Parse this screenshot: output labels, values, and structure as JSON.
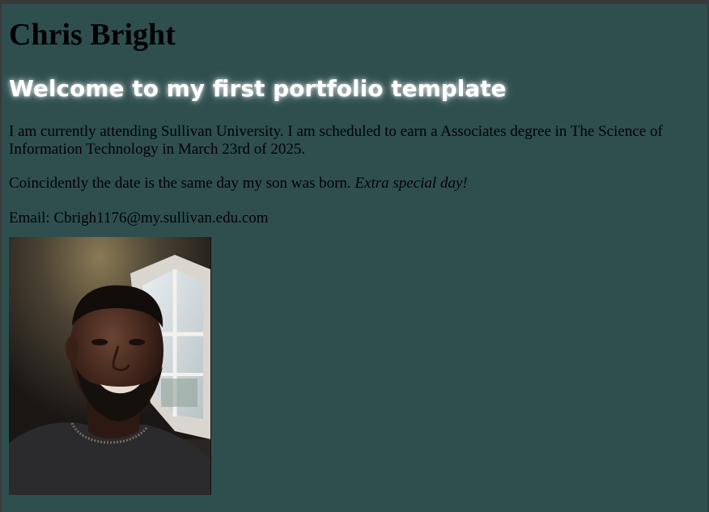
{
  "header": {
    "name": "Chris Bright",
    "welcome": "Welcome to my first portfolio template"
  },
  "content": {
    "intro": "I am currently attending Sullivan University. I am scheduled to earn a Associates degree in The Science of Information Technology in March 23rd of 2025.",
    "coincidence": "Coincidently the date is the same day my son was born.",
    "coincidence_emphasis": "Extra special day!",
    "email": "Email: Cbrigh1176@my.sullivan.edu.com"
  },
  "photo": {
    "subject": "portrait-photo"
  },
  "colors": {
    "background": "#2f4f4f",
    "heading_glow": "#ffffff",
    "text": "#000000"
  }
}
